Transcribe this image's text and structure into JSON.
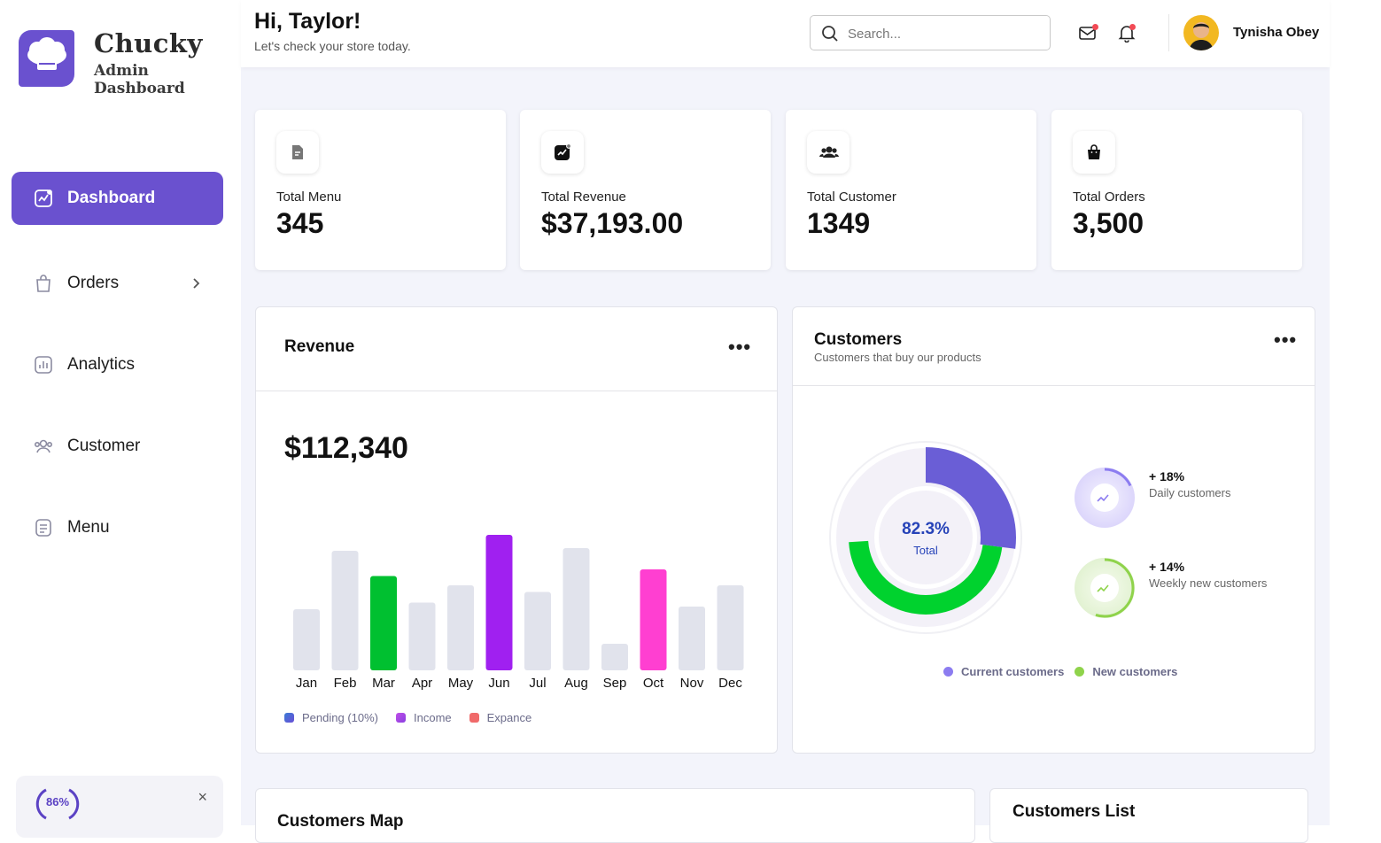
{
  "brand": {
    "name": "Chucky",
    "subtitle": "Admin Dashboard"
  },
  "sidebar": {
    "items": [
      {
        "label": "Dashboard",
        "icon": "chart-icon",
        "active": true
      },
      {
        "label": "Orders",
        "icon": "bag-icon",
        "has_submenu": true
      },
      {
        "label": "Analytics",
        "icon": "analytics-icon"
      },
      {
        "label": "Customer",
        "icon": "users-icon"
      },
      {
        "label": "Menu",
        "icon": "document-icon"
      }
    ],
    "promo": {
      "progress_label": "86%",
      "progress_value": 0.86,
      "close": "×"
    }
  },
  "header": {
    "greeting": "Hi, Taylor!",
    "subtitle": "Let's check your store today.",
    "search": {
      "placeholder": "Search...",
      "value": ""
    },
    "user": {
      "name": "Tynisha Obey"
    }
  },
  "stats": [
    {
      "label": "Total Menu",
      "value": "345",
      "icon": "file-icon"
    },
    {
      "label": "Total Revenue",
      "value": "$37,193.00",
      "icon": "revenue-icon"
    },
    {
      "label": "Total Customer",
      "value": "1349",
      "icon": "group-icon"
    },
    {
      "label": "Total Orders",
      "value": "3,500",
      "icon": "shopping-bag-icon"
    }
  ],
  "revenue": {
    "title": "Revenue",
    "more": "•••",
    "amount": "$112,340",
    "legend": [
      {
        "label": "Pending (10%)",
        "color": "#4a6fd6"
      },
      {
        "label": "Income",
        "color": "#a24fe0"
      },
      {
        "label": "Expance",
        "color": "#f06a6a"
      }
    ]
  },
  "customers": {
    "title": "Customers",
    "subtitle": "Customers that buy our products",
    "more": "•••",
    "donut": {
      "value": "82.3%",
      "label": "Total",
      "current_share": 0.3,
      "new_share": 0.47
    },
    "stats": [
      {
        "value": "+ 18%",
        "label": "Daily customers",
        "color": "#7b6ee6",
        "fraction": 0.18
      },
      {
        "value": "+ 14%",
        "label": "Weekly new customers",
        "color": "#8fd34b",
        "fraction": 0.55
      }
    ],
    "legend": [
      {
        "label": "Current customers",
        "color": "#8c7cf0"
      },
      {
        "label": "New customers",
        "color": "#8fd34b"
      }
    ]
  },
  "bottom": {
    "map_title": "Customers Map",
    "list_title": "Customers List"
  },
  "chart_data": {
    "type": "bar",
    "categories": [
      "Jan",
      "Feb",
      "Mar",
      "Apr",
      "May",
      "Jun",
      "Jul",
      "Aug",
      "Sep",
      "Oct",
      "Nov",
      "Dec"
    ],
    "values": [
      46,
      90,
      71,
      51,
      64,
      102,
      59,
      92,
      20,
      76,
      48,
      64
    ],
    "colors": [
      "#e1e3ec",
      "#e1e3ec",
      "#00c030",
      "#e1e3ec",
      "#e1e3ec",
      "#a020f0",
      "#e1e3ec",
      "#e1e3ec",
      "#e1e3ec",
      "#ff3fd1",
      "#e1e3ec",
      "#e1e3ec"
    ],
    "ylim": [
      0,
      110
    ],
    "grid": false,
    "legend_position": "bottom-left"
  }
}
